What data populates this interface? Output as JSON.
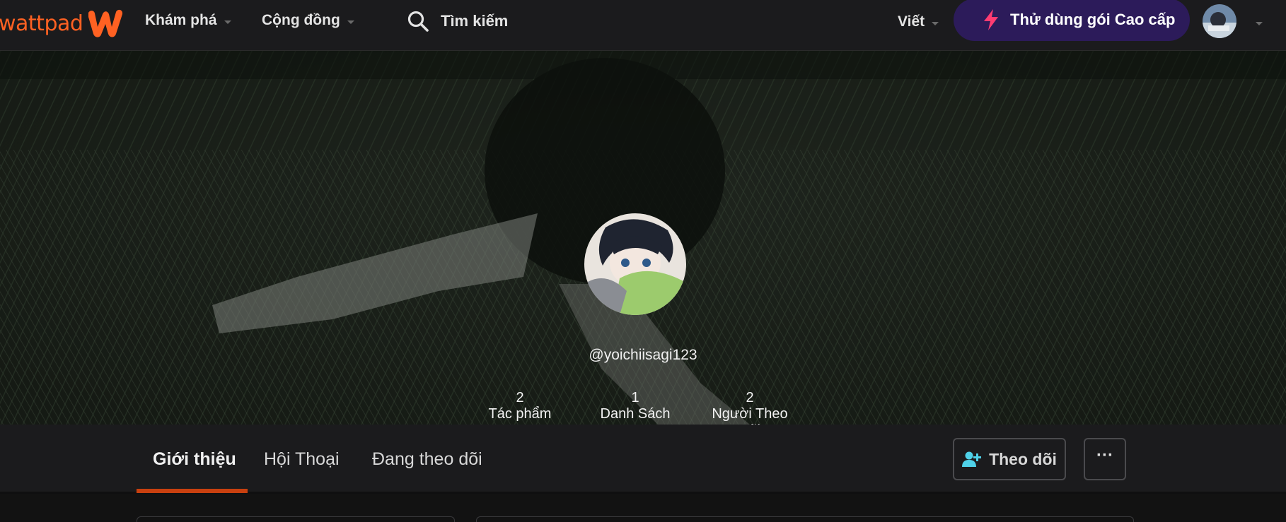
{
  "nav": {
    "logo_text": "wattpad",
    "explore": "Khám phá",
    "community": "Cộng đồng",
    "search_label": "Tìm kiếm",
    "write": "Viết",
    "premium": "Thử dùng gói Cao cấp",
    "brand_color": "#ff6122",
    "premium_bg": "#2c1b5a",
    "premium_icon_color": "#ff3c72"
  },
  "profile": {
    "username": "@yoichiisagi123",
    "stats": [
      {
        "value": "2",
        "label": "Tác phẩm"
      },
      {
        "value": "1",
        "label": "Danh Sách Đọc"
      },
      {
        "value": "2",
        "label": "Người Theo Dõi"
      }
    ]
  },
  "tabs": {
    "about": "Giới thiệu",
    "conversations": "Hội Thoại",
    "following": "Đang theo dõi",
    "active": "about",
    "accent": "#c8400f"
  },
  "actions": {
    "follow": "Theo dõi",
    "more": "···",
    "follow_icon_color": "#4fd1e8"
  }
}
